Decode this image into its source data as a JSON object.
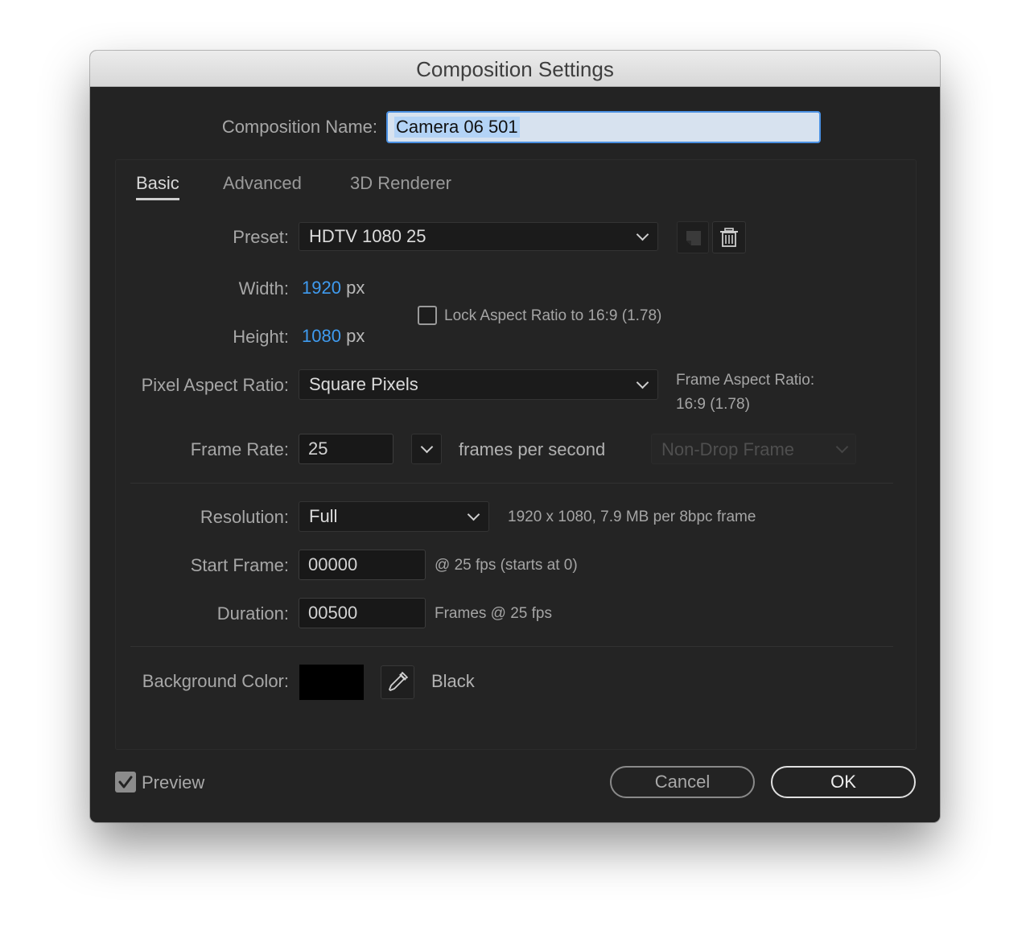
{
  "window": {
    "title": "Composition Settings"
  },
  "comp_name": {
    "label": "Composition Name:",
    "value": "Camera 06 501"
  },
  "tabs": [
    {
      "label": "Basic"
    },
    {
      "label": "Advanced"
    },
    {
      "label": "3D Renderer"
    }
  ],
  "preset": {
    "label": "Preset:",
    "value": "HDTV 1080 25"
  },
  "width": {
    "label": "Width:",
    "value": "1920",
    "unit": "px"
  },
  "height": {
    "label": "Height:",
    "value": "1080",
    "unit": "px"
  },
  "lock_aspect": {
    "label": "Lock Aspect Ratio to 16:9 (1.78)",
    "checked": false
  },
  "pixel_aspect": {
    "label": "Pixel Aspect Ratio:",
    "value": "Square Pixels"
  },
  "frame_aspect": {
    "label": "Frame Aspect Ratio:",
    "value": "16:9 (1.78)"
  },
  "frame_rate": {
    "label": "Frame Rate:",
    "value": "25",
    "unit": "frames per second",
    "drop_frame": "Non-Drop Frame"
  },
  "resolution": {
    "label": "Resolution:",
    "value": "Full",
    "info": "1920 x 1080, 7.9 MB per 8bpc frame"
  },
  "start_frame": {
    "label": "Start Frame:",
    "value": "00000",
    "info": "@ 25 fps (starts at 0)"
  },
  "duration": {
    "label": "Duration:",
    "value": "00500",
    "info": "Frames @ 25 fps"
  },
  "background": {
    "label": "Background Color:",
    "name": "Black",
    "color": "#000000"
  },
  "preview": {
    "label": "Preview",
    "checked": true
  },
  "buttons": {
    "cancel": "Cancel",
    "ok": "OK"
  },
  "colors": {
    "accent": "#3f9bef",
    "dialog_bg": "#232323",
    "text": "#a7a7a7"
  },
  "icons": {
    "preset_save": "save-preset-icon",
    "preset_delete": "trash-icon",
    "eyedropper": "eyedropper-icon",
    "checkmark": "checkmark-icon"
  }
}
